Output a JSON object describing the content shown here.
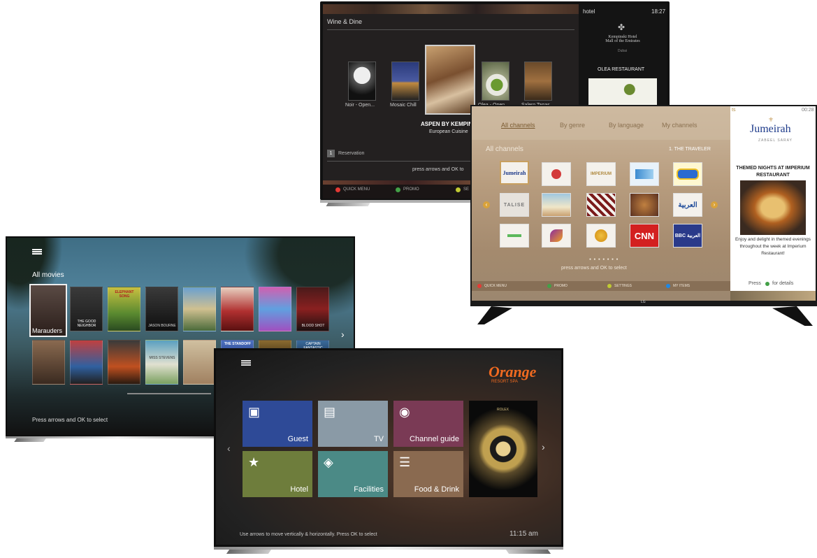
{
  "tv1": {
    "section_title": "Wine & Dine",
    "hotel_label": "hotel",
    "clock": "18:27",
    "sidebar_hotel_name": "Kempinski Hotel\nMall of the Emirates",
    "sidebar_city": "Dubai",
    "sidebar_restaurant": "OLEA RESTAURANT",
    "carousel": [
      "Noir - Open...",
      "Mosaic Chill",
      "",
      "Olea - Open...",
      "Salero Tapas"
    ],
    "featured_title": "ASPEN BY KEMPIN",
    "featured_subtitle": "European Cuisine",
    "reservation_label": "Reservation",
    "reservation_key": "1",
    "hint": "press arrows and OK to",
    "buttons": [
      "QUICK MENU",
      "PROMO",
      "SE"
    ],
    "colors": {
      "red": "#e53935",
      "green": "#43a047",
      "yellow": "#c0ca33"
    }
  },
  "tv2": {
    "tabs": [
      "All channels",
      "By genre",
      "By language",
      "My channels"
    ],
    "list_title": "All channels",
    "list_right": "1. THE TRAVELER",
    "clock": "00:28",
    "corner_label": "ts",
    "channels": [
      {
        "name": "Jumeirah",
        "icon": "jumeirah-logo"
      },
      {
        "name": "",
        "icon": "red-circle-logo"
      },
      {
        "name": "IMPERIUM",
        "icon": "imperium-logo"
      },
      {
        "name": "",
        "icon": "blue-logo"
      },
      {
        "name": "",
        "icon": "cartoon-logo"
      },
      {
        "name": "TALISE",
        "icon": "talise-logo"
      },
      {
        "name": "",
        "icon": "beach-photo"
      },
      {
        "name": "",
        "icon": "stripe-logo"
      },
      {
        "name": "",
        "icon": "food-photo"
      },
      {
        "name": "العربية",
        "icon": "alarabiya-logo"
      },
      {
        "name": "",
        "icon": "green-logo"
      },
      {
        "name": "",
        "icon": "purple-wave-logo"
      },
      {
        "name": "",
        "icon": "aljazeera-logo"
      },
      {
        "name": "CNN",
        "icon": "cnn-logo"
      },
      {
        "name": "BBC العربية",
        "icon": "bbc-arabic-logo"
      }
    ],
    "hint": "press arrows and OK to select",
    "footer_buttons": [
      "QUICK MENU",
      "PROMO",
      "SETTINGS",
      "MY ITEMS"
    ],
    "side_brand": "Jumeirah",
    "side_sub": "ZABEEL SARAY",
    "side_title": "THEMED NIGHTS AT IMPERIUM RESTAURANT",
    "side_body": "Enjoy and delight in themed evenings throughout the week at Imperium Restaurant!",
    "side_press": "Press",
    "side_details": "for details",
    "stand_logo": "LG"
  },
  "tv3": {
    "title": "All movies",
    "selected_label": "Marauders",
    "poster_texts": [
      "",
      "THE GOOD NEIGHBOR",
      "ELEPHANT SONG",
      "JASON BOURNE",
      "",
      "",
      "",
      "BLOOD SHOT",
      "",
      "",
      "",
      "",
      "MISS STEVENS",
      "",
      "THE STANDOFF",
      "",
      "CAPTAIN FANTASTIC"
    ],
    "hint": "Press arrows and OK to select",
    "next_icon": "chevron-right-icon"
  },
  "tv4": {
    "brand": "Orange",
    "brand_sub": "RESORT SPA",
    "tiles": [
      {
        "label": "Guest",
        "icon": "briefcase-icon",
        "color": "#2e4a97"
      },
      {
        "label": "TV",
        "icon": "tv-icon",
        "color": "#8a9aa6"
      },
      {
        "label": "Channel guide",
        "icon": "eye-icon",
        "color": "#7a3a55"
      },
      {
        "label": "Hotel",
        "icon": "star-icon",
        "color": "#6e7d3c"
      },
      {
        "label": "Facilities",
        "icon": "tag-icon",
        "color": "#4b8a86"
      },
      {
        "label": "Food & Drink",
        "icon": "cutlery-icon",
        "color": "#8a6a50"
      }
    ],
    "ad_brand": "ROLEX",
    "hint": "Use arrows to move vertically & horizontally. Press OK to select",
    "clock": "11:15 am"
  }
}
